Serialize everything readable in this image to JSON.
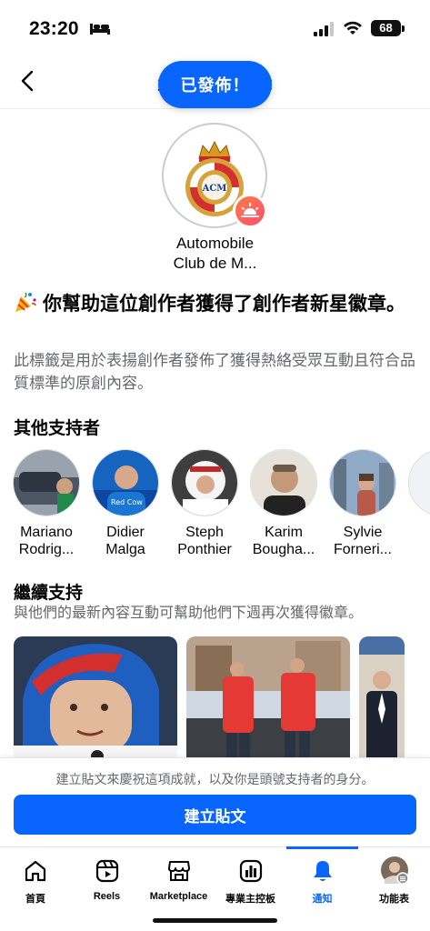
{
  "status_bar": {
    "time": "23:20",
    "battery": "68"
  },
  "header": {
    "title": "創作者新星徽章",
    "toast": "已發佈！"
  },
  "profile": {
    "name_line1": "Automobile",
    "name_line2": "Club de M..."
  },
  "headline": "你幫助這位創作者獲得了創作者新星徽章。",
  "description": "此標籤是用於表揚創作者發佈了獲得熱絡受眾互動且符合品質標準的原創內容。",
  "other_supporters": {
    "title": "其他支持者",
    "people": [
      {
        "first": "Mariano",
        "last": "Rodrig..."
      },
      {
        "first": "Didier",
        "last": "Malga"
      },
      {
        "first": "Steph",
        "last": "Ponthier"
      },
      {
        "first": "Karim",
        "last": "Bougha..."
      },
      {
        "first": "Sylvie",
        "last": "Forneri..."
      }
    ]
  },
  "continue_support": {
    "title": "繼續支持",
    "subtitle": "與他們的最新內容互動可幫助他們下週再次獲得徽章。"
  },
  "bottom_sheet": {
    "text": "建立貼文來慶祝這項成就，以及你是頭號支持者的身分。",
    "button": "建立貼文"
  },
  "tabbar": {
    "tabs": [
      {
        "label": "首頁",
        "icon": "home-icon"
      },
      {
        "label": "Reels",
        "icon": "reels-icon"
      },
      {
        "label": "Marketplace",
        "icon": "marketplace-icon"
      },
      {
        "label": "專業主控板",
        "icon": "dashboard-icon"
      },
      {
        "label": "通知",
        "icon": "bell-icon",
        "active": true
      },
      {
        "label": "功能表",
        "icon": "profile-menu-icon"
      }
    ]
  },
  "colors": {
    "accent": "#0866ff",
    "secondary_text": "#65676b"
  }
}
